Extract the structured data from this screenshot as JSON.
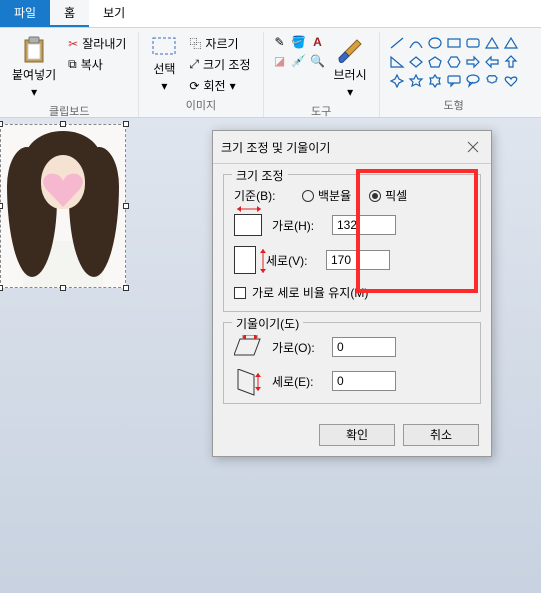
{
  "menubar": {
    "file": "파일",
    "home": "홈",
    "view": "보기"
  },
  "ribbon": {
    "clipboard": {
      "paste": "붙여넣기",
      "cut": "잘라내기",
      "copy": "복사",
      "group": "클립보드"
    },
    "image": {
      "select": "선택",
      "crop": "자르기",
      "resize": "크기 조정",
      "rotate": "회전",
      "group": "이미지"
    },
    "tools": {
      "brush": "브러시",
      "group": "도구"
    },
    "shapes": {
      "group": "도형"
    }
  },
  "dialog": {
    "title": "크기 조정 및 기울이기",
    "resize": {
      "legend": "크기 조정",
      "basis": "기준(B):",
      "percent": "백분율",
      "pixel": "픽셀",
      "horiz": "가로(H):",
      "vert": "세로(V):",
      "width_val": "132",
      "height_val": "170",
      "aspect": "가로 세로 비율 유지(M)"
    },
    "skew": {
      "legend": "기울이기(도)",
      "horiz": "가로(O):",
      "vert": "세로(E):",
      "h_val": "0",
      "v_val": "0"
    },
    "ok": "확인",
    "cancel": "취소"
  }
}
